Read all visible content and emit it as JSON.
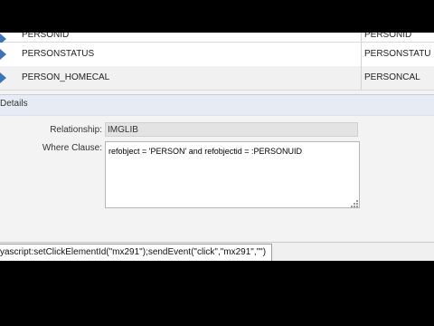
{
  "table": {
    "rows": [
      {
        "col1": "PERSONID",
        "col2": "PERSONID"
      },
      {
        "col1": "PERSONSTATUS",
        "col2": "PERSONSTATU"
      },
      {
        "col1": "PERSON_HOMECAL",
        "col2": "PERSONCAL"
      }
    ]
  },
  "details": {
    "title": "Details",
    "relationship_label": "Relationship:",
    "relationship_value": "IMGLIB",
    "where_clause_label": "Where Clause:",
    "where_clause_value": "refobject = 'PERSON' and refobjectid = :PERSONUID"
  },
  "status_bar": {
    "url": "yascript:setClickElementId(\"mx291\");sendEvent(\"click\",\"mx291\",\"\")"
  },
  "colors": {
    "arrow": "#3f73b6",
    "details_header_bg": "#e7ebf3",
    "letterbox": "#000000"
  }
}
